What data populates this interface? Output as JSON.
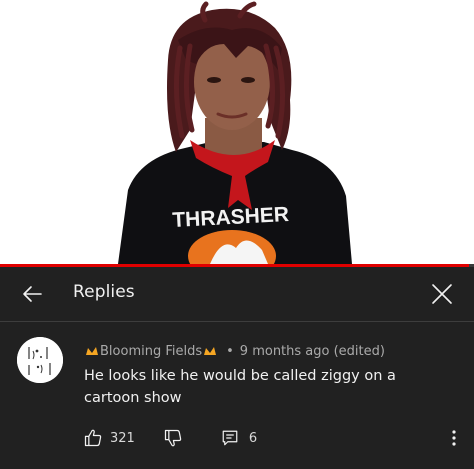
{
  "header": {
    "title": "Replies",
    "back_icon": "arrow-left-icon",
    "close_icon": "close-icon"
  },
  "video": {
    "shirt_text": "THRASHER",
    "progress_fraction": 0.99
  },
  "comment": {
    "author": "Blooming Fields",
    "separator": "•",
    "timestamp": "9 months ago (edited)",
    "text": "He looks like he would be called ziggy on a cartoon show",
    "like_count": "321",
    "reply_count": "6",
    "author_badge_color": "#f5a623"
  },
  "colors": {
    "panel_bg": "#212121",
    "primary_text": "#f1f1f1",
    "secondary_text": "#aaaaaa",
    "progress": "#e00000"
  }
}
